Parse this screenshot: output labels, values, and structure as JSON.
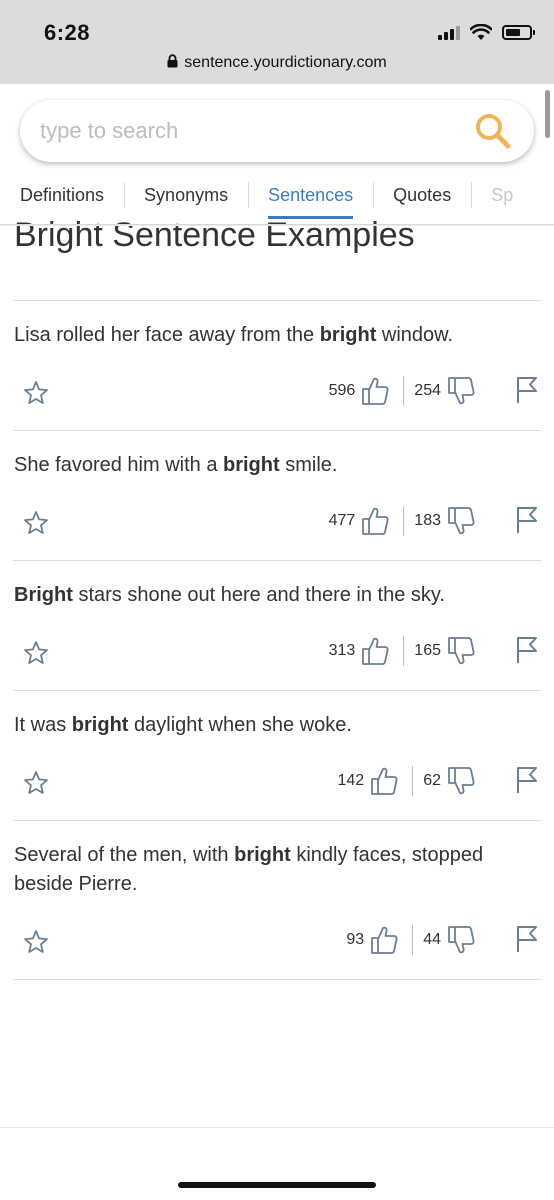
{
  "status_bar": {
    "time": "6:28"
  },
  "browser": {
    "url": "sentence.yourdictionary.com"
  },
  "search": {
    "placeholder": "type to search",
    "value": ""
  },
  "tabs": [
    {
      "label": "Definitions"
    },
    {
      "label": "Synonyms"
    },
    {
      "label": "Sentences",
      "active": true
    },
    {
      "label": "Quotes"
    },
    {
      "label": "Sp"
    }
  ],
  "page": {
    "title": "Bright Sentence Examples"
  },
  "sentences": [
    {
      "before": "Lisa rolled her face away from the ",
      "keyword": "bright",
      "after": " window.",
      "upvotes": "596",
      "downvotes": "254"
    },
    {
      "before": "She favored him with a ",
      "keyword": "bright",
      "after": " smile.",
      "upvotes": "477",
      "downvotes": "183"
    },
    {
      "before": "",
      "keyword": "Bright",
      "after": " stars shone out here and there in the sky.",
      "upvotes": "313",
      "downvotes": "165"
    },
    {
      "before": "It was ",
      "keyword": "bright",
      "after": " daylight when she woke.",
      "upvotes": "142",
      "downvotes": "62"
    },
    {
      "before": "Several of the men, with ",
      "keyword": "bright",
      "after": " kindly faces, stopped beside Pierre.",
      "upvotes": "93",
      "downvotes": "44"
    }
  ],
  "colors": {
    "accent": "#3c7ebd",
    "search_icon": "#f2b45a",
    "icon_gray": "#6b7f93",
    "chrome_bg": "#dcdcdc"
  },
  "icons": [
    "lock-icon",
    "search-icon",
    "star-icon",
    "thumbs-up-icon",
    "thumbs-down-icon",
    "flag-icon",
    "wifi-icon",
    "battery-icon",
    "signal-icon"
  ]
}
